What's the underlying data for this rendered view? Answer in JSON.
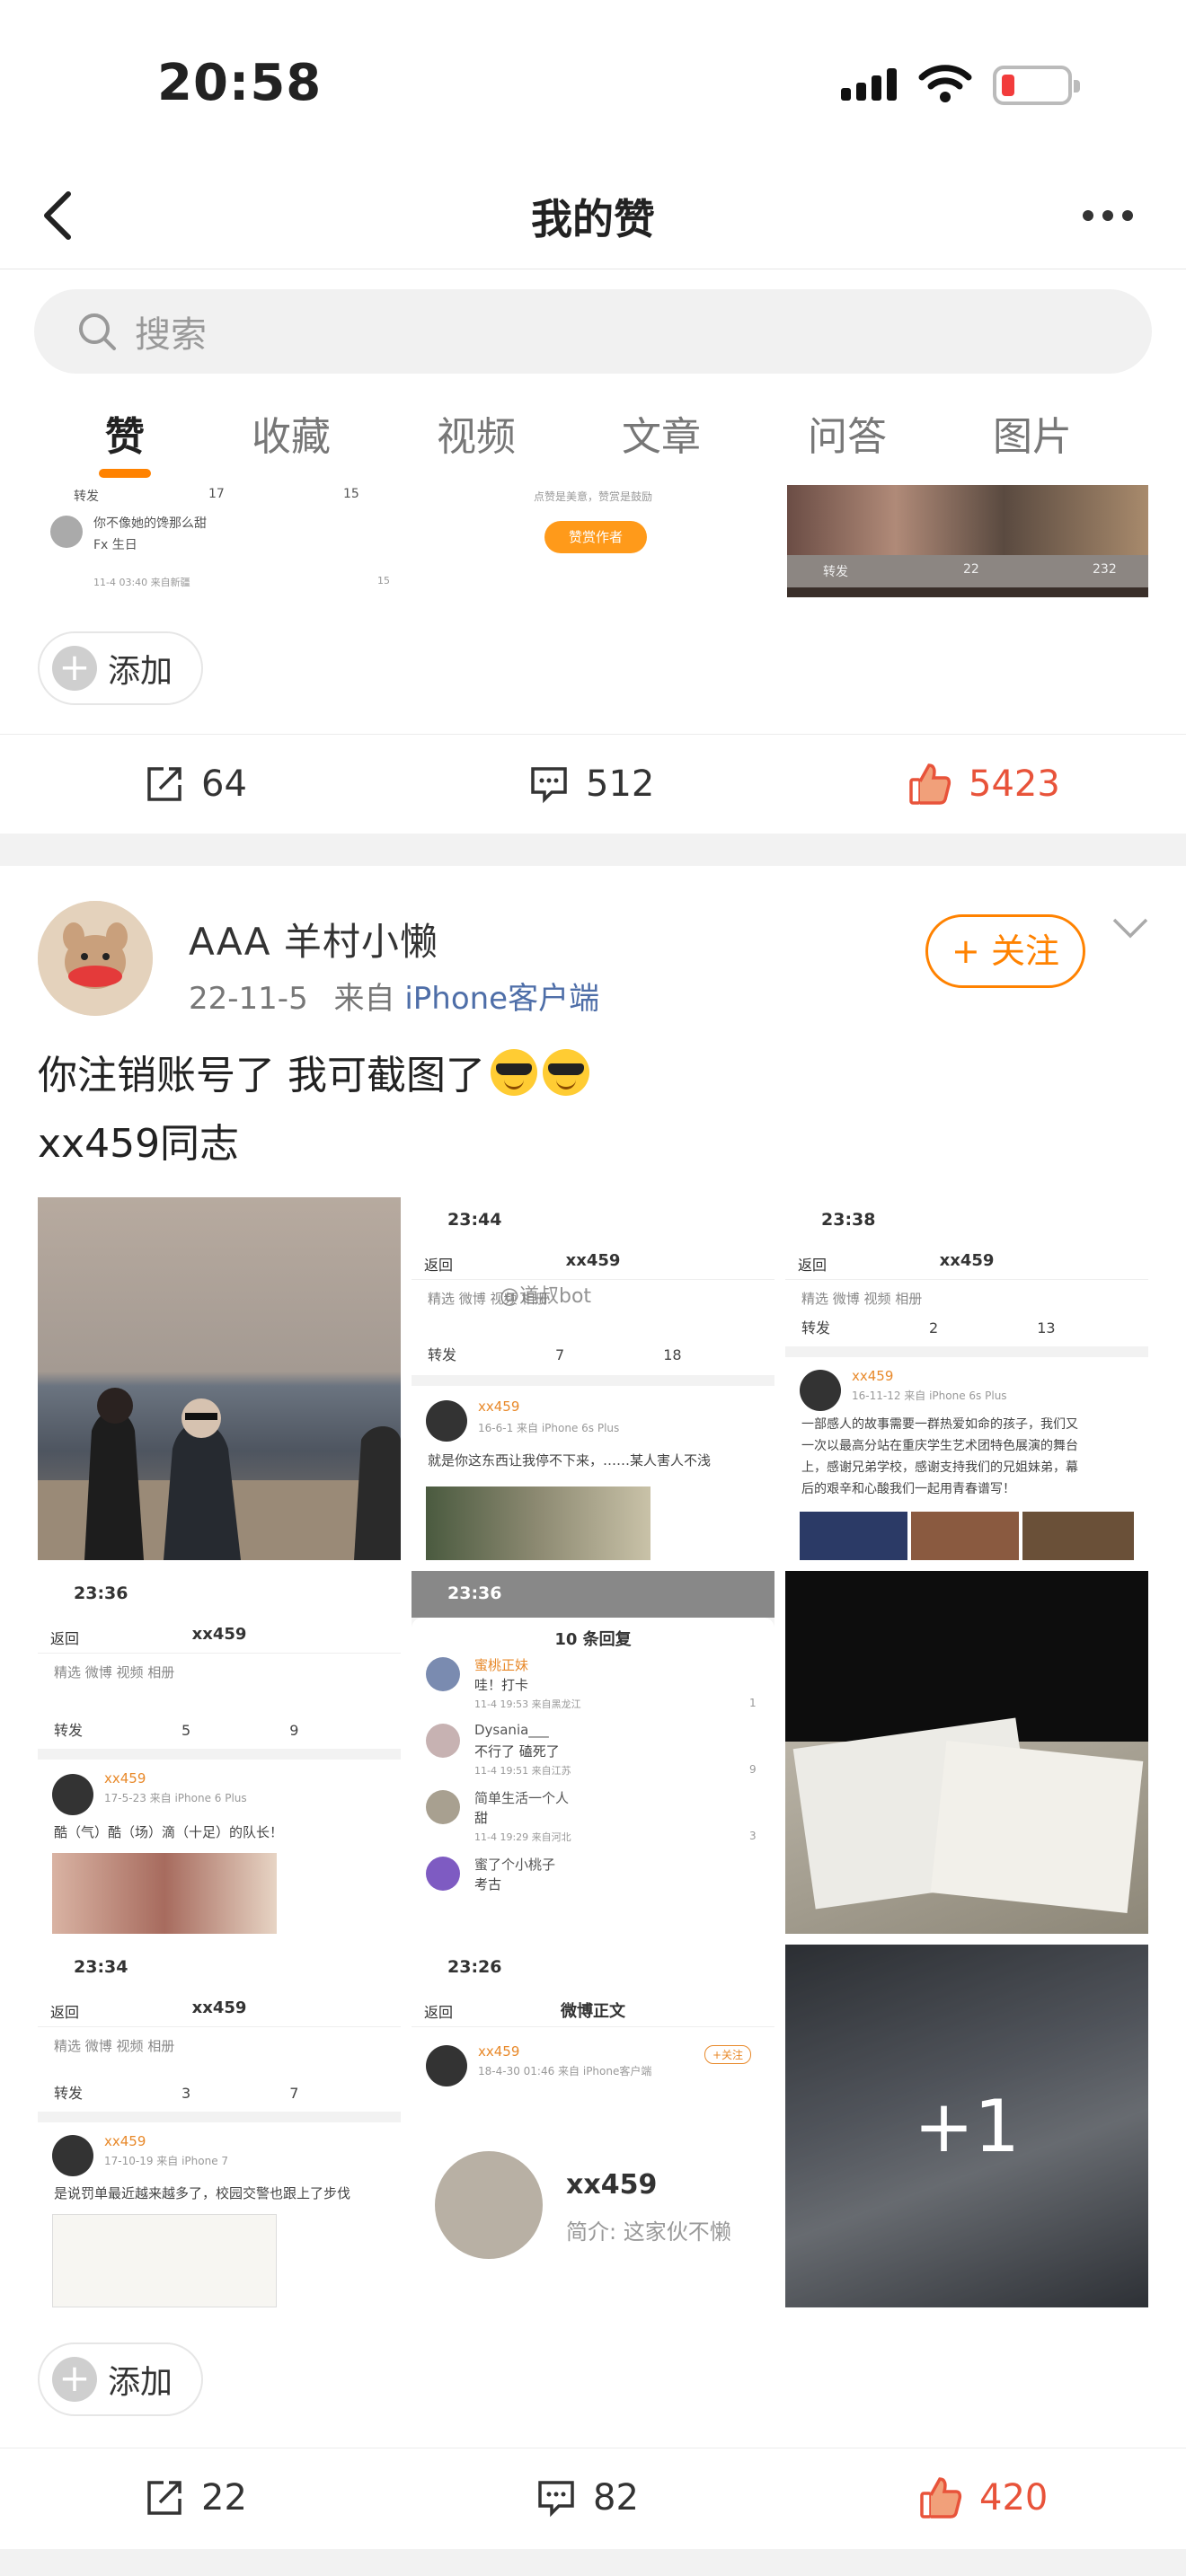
{
  "status_bar": {
    "time": "20:58"
  },
  "nav": {
    "title": "我的赞"
  },
  "search": {
    "placeholder": "搜索"
  },
  "tabs": [
    {
      "label": "赞",
      "active": true
    },
    {
      "label": "收藏"
    },
    {
      "label": "视频"
    },
    {
      "label": "文章"
    },
    {
      "label": "问答"
    },
    {
      "label": "图片"
    }
  ],
  "prev_post": {
    "thumb1": {
      "repost": "转发",
      "comments": "17",
      "likes": "15",
      "line1": "你不像她的馋那么甜",
      "line2": "Fx 生日",
      "meta": "11-4 03:40 来自新疆",
      "likes2": "15"
    },
    "thumb2": {
      "caption": "点赞是美意，赞赏是鼓励",
      "button": "赞赏作者"
    },
    "thumb3": {
      "repost": "转发",
      "comments": "22",
      "likes": "232"
    },
    "add_label": "添加",
    "reposts": "64",
    "comments": "512",
    "likes": "5423"
  },
  "post": {
    "username": "AAA 羊村小懒",
    "date": "22-11-5",
    "source_prefix": "来自",
    "source": "iPhone客户端",
    "follow_label": "+ 关注",
    "text_line1": "你注销账号了 我可截图了",
    "text_line2": "xx459同志",
    "add_label": "添加",
    "reposts": "22",
    "comments": "82",
    "likes": "420"
  },
  "grid": {
    "s2": {
      "time": "23:44",
      "title": "xx459",
      "back": "返回",
      "tabs": "精选    微博    视频    相册",
      "repost": "转发",
      "comments": "7",
      "likes": "18",
      "name": "xx459",
      "meta": "16-6-1 来自 iPhone 6s Plus",
      "body": "就是你这东西让我停不下来，……某人害人不浅",
      "watermark": "@道叔bot"
    },
    "s3": {
      "time": "23:38",
      "title": "xx459",
      "back": "返回",
      "tabs": "精选    微博    视频    相册",
      "repost": "转发",
      "comments": "2",
      "likes": "13",
      "name": "xx459",
      "meta": "16-11-12 来自 iPhone 6s Plus",
      "body1": "一部感人的故事需要一群热爱如命的孩子，我们又",
      "body2": "一次以最高分站在重庆学生艺术团特色展演的舞台",
      "body3": "上，感谢兄弟学校，感谢支持我们的兄姐妹弟，幕",
      "body4": "后的艰辛和心酸我们一起用青春谱写！"
    },
    "s4": {
      "time": "23:36",
      "title": "xx459",
      "back": "返回",
      "tabs": "精选    微博    视频    相册",
      "repost": "转发",
      "comments": "5",
      "likes": "9",
      "name": "xx459",
      "meta": "17-5-23 来自 iPhone 6 Plus",
      "body": "酷（气）酷（场）滴（十足）的队长！"
    },
    "s5": {
      "time": "23:36",
      "title": "10 条回复",
      "r1name": "蜜桃正妹",
      "r1text": "哇！打卡",
      "r1meta": "11-4 19:53 来自黑龙江",
      "r1likes": "1",
      "r2name": "Dysania___",
      "r2text": "不行了 磕死了",
      "r2meta": "11-4 19:51 来自江苏",
      "r2likes": "9",
      "r3name": "简单生活一个人",
      "r3text": "甜",
      "r3meta": "11-4 19:29 来自河北",
      "r3likes": "3",
      "r4name": "蜜了个小桃子",
      "r4text": "考古"
    },
    "s7": {
      "time": "23:34",
      "title": "xx459",
      "back": "返回",
      "tabs": "精选    微博    视频    相册",
      "repost": "转发",
      "comments": "3",
      "likes": "7",
      "name": "xx459",
      "meta": "17-10-19 来自 iPhone 7",
      "body": "是说罚单最近越来越多了，校园交警也跟上了步伐"
    },
    "s8": {
      "time": "23:26",
      "title": "微博正文",
      "back": "返回",
      "name": "xx459",
      "meta": "18-4-30 01:46 来自 iPhone客户端",
      "follow": "+关注",
      "card_name": "xx459",
      "card_bio": "简介: 这家伙不懒"
    },
    "more": "+1"
  }
}
